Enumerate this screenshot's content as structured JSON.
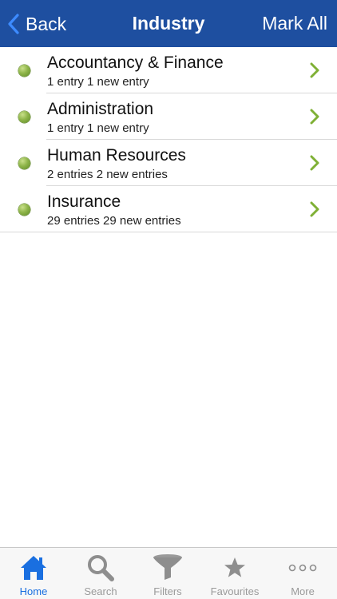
{
  "navbar": {
    "back_label": "Back",
    "title": "Industry",
    "mark_all_label": "Mark All",
    "background_color": "#1e4fa0"
  },
  "items": [
    {
      "title": "Accountancy & Finance",
      "subtitle": "1 entry 1 new entry"
    },
    {
      "title": "Administration",
      "subtitle": "1 entry 1 new entry"
    },
    {
      "title": "Human Resources",
      "subtitle": "2 entries 2 new entries"
    },
    {
      "title": "Insurance",
      "subtitle": "29 entries 29 new entries"
    }
  ],
  "tabbar": {
    "active_color": "#1a6fe0",
    "inactive_color": "#9a9a9a",
    "tabs": [
      {
        "label": "Home",
        "icon": "home-icon",
        "active": true
      },
      {
        "label": "Search",
        "icon": "search-icon",
        "active": false
      },
      {
        "label": "Filters",
        "icon": "funnel-icon",
        "active": false
      },
      {
        "label": "Favourites",
        "icon": "star-icon",
        "active": false
      },
      {
        "label": "More",
        "icon": "more-dots-icon",
        "active": false
      }
    ]
  }
}
